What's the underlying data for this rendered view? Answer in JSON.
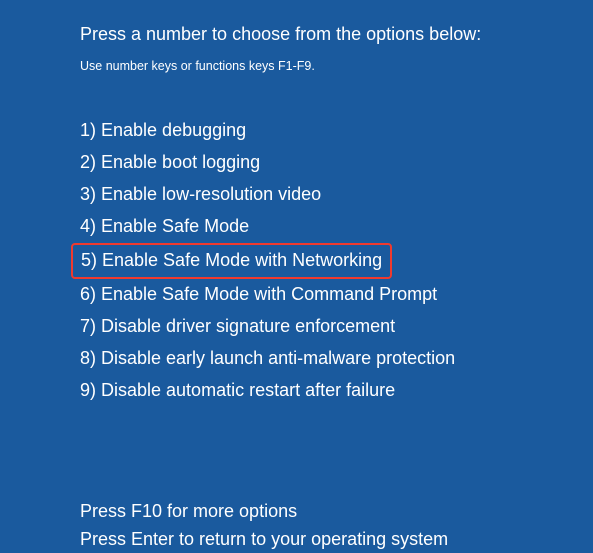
{
  "title": "Press a number to choose from the options below:",
  "subtitle": "Use number keys or functions keys F1-F9.",
  "options": [
    {
      "label": "1) Enable debugging",
      "highlighted": false
    },
    {
      "label": "2) Enable boot logging",
      "highlighted": false
    },
    {
      "label": "3) Enable low-resolution video",
      "highlighted": false
    },
    {
      "label": "4) Enable Safe Mode",
      "highlighted": false
    },
    {
      "label": "5) Enable Safe Mode with Networking",
      "highlighted": true
    },
    {
      "label": "6) Enable Safe Mode with Command Prompt",
      "highlighted": false
    },
    {
      "label": "7) Disable driver signature enforcement",
      "highlighted": false
    },
    {
      "label": "8) Disable early launch anti-malware protection",
      "highlighted": false
    },
    {
      "label": "9) Disable automatic restart after failure",
      "highlighted": false
    }
  ],
  "footer": {
    "line1": "Press F10 for more options",
    "line2": "Press Enter to return to your operating system"
  }
}
